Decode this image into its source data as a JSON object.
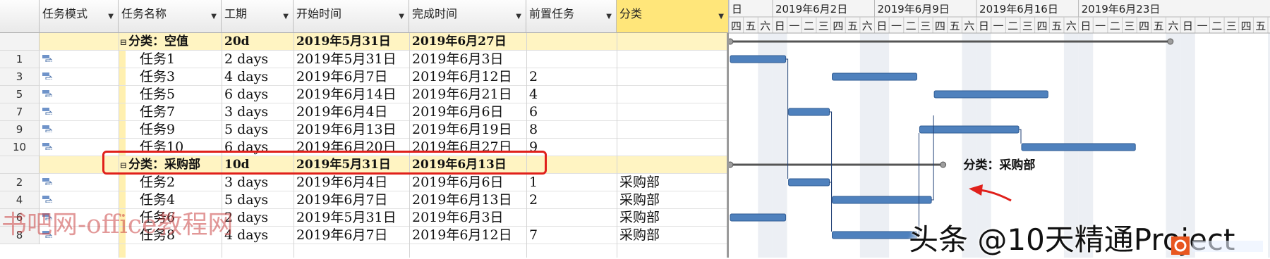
{
  "columns": [
    "任务模式",
    "任务名称",
    "工期",
    "开始时间",
    "完成时间",
    "前置任务",
    "分类"
  ],
  "rows": [
    {
      "id": "",
      "group": true,
      "name": "分类：空值",
      "duration": "20d",
      "start": "2019年5月31日",
      "finish": "2019年6月27日",
      "pred": "",
      "category": ""
    },
    {
      "id": "1",
      "group": false,
      "name": "任务1",
      "duration": "2 days",
      "start": "2019年5月31日",
      "finish": "2019年6月3日",
      "pred": "",
      "category": ""
    },
    {
      "id": "3",
      "group": false,
      "name": "任务3",
      "duration": "4 days",
      "start": "2019年6月7日",
      "finish": "2019年6月12日",
      "pred": "2",
      "category": ""
    },
    {
      "id": "5",
      "group": false,
      "name": "任务5",
      "duration": "6 days",
      "start": "2019年6月14日",
      "finish": "2019年6月21日",
      "pred": "4",
      "category": ""
    },
    {
      "id": "7",
      "group": false,
      "name": "任务7",
      "duration": "3 days",
      "start": "2019年6月4日",
      "finish": "2019年6月6日",
      "pred": "6",
      "category": ""
    },
    {
      "id": "9",
      "group": false,
      "name": "任务9",
      "duration": "5 days",
      "start": "2019年6月13日",
      "finish": "2019年6月19日",
      "pred": "8",
      "category": ""
    },
    {
      "id": "10",
      "group": false,
      "name": "任务10",
      "duration": "6 days",
      "start": "2019年6月20日",
      "finish": "2019年6月27日",
      "pred": "9",
      "category": ""
    },
    {
      "id": "",
      "group": true,
      "name": "分类：采购部",
      "duration": "10d",
      "start": "2019年5月31日",
      "finish": "2019年6月13日",
      "pred": "",
      "category": ""
    },
    {
      "id": "2",
      "group": false,
      "name": "任务2",
      "duration": "3 days",
      "start": "2019年6月4日",
      "finish": "2019年6月6日",
      "pred": "1",
      "category": "采购部"
    },
    {
      "id": "4",
      "group": false,
      "name": "任务4",
      "duration": "5 days",
      "start": "2019年6月7日",
      "finish": "2019年6月13日",
      "pred": "2",
      "category": "采购部"
    },
    {
      "id": "6",
      "group": false,
      "name": "任务6",
      "duration": "2 days",
      "start": "2019年5月31日",
      "finish": "2019年6月3日",
      "pred": "",
      "category": "采购部"
    },
    {
      "id": "8",
      "group": false,
      "name": "任务8",
      "duration": "4 days",
      "start": "2019年6月7日",
      "finish": "2019年6月12日",
      "pred": "7",
      "category": "采购部"
    }
  ],
  "gantt": {
    "weeks": [
      "日",
      "2019年6月2日",
      "2019年6月9日",
      "2019年6月16日",
      "2019年6月23日"
    ],
    "days": [
      "四",
      "五",
      "六",
      "日",
      "一",
      "二",
      "三",
      "四",
      "五",
      "六",
      "日",
      "一",
      "二",
      "三",
      "四",
      "五",
      "六",
      "日",
      "一",
      "二",
      "三",
      "四",
      "五",
      "六",
      "日",
      "一",
      "二",
      "三",
      "四",
      "五",
      "六",
      "日",
      "一",
      "二",
      "三",
      "四",
      "五",
      "六"
    ],
    "group_label": "分类：采购部",
    "bars": [
      {
        "row": 1,
        "start": 0,
        "dur": 4
      },
      {
        "row": 2,
        "start": 7,
        "dur": 6
      },
      {
        "row": 3,
        "start": 14,
        "dur": 8
      },
      {
        "row": 4,
        "start": 4,
        "dur": 3
      },
      {
        "row": 5,
        "start": 13,
        "dur": 7
      },
      {
        "row": 6,
        "start": 20,
        "dur": 8
      },
      {
        "row": 8,
        "start": 4,
        "dur": 3
      },
      {
        "row": 9,
        "start": 7,
        "dur": 7
      },
      {
        "row": 10,
        "start": 0,
        "dur": 4
      },
      {
        "row": 11,
        "start": 7,
        "dur": 6
      }
    ]
  },
  "watermark_left": "书吧网-office教程网",
  "watermark_right": "头条 @10天精通Project",
  "colors": {
    "group_bg": "#fff4c2",
    "selected_header": "#ffe67a",
    "bar": "#4f81bd",
    "highlight": "#e0201b"
  }
}
